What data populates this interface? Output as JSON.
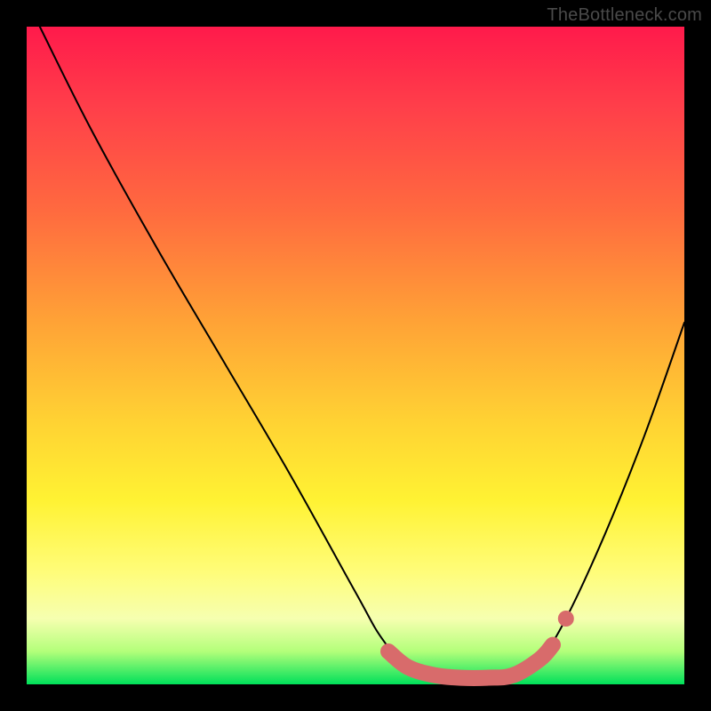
{
  "attribution": "TheBottleneck.com",
  "chart_data": {
    "type": "line",
    "title": "",
    "xlabel": "",
    "ylabel": "",
    "xlim": [
      0,
      100
    ],
    "ylim": [
      0,
      100
    ],
    "grid": false,
    "legend": false,
    "annotations": [],
    "series": [
      {
        "name": "curve",
        "color": "#000000",
        "x": [
          2,
          10,
          20,
          30,
          40,
          50,
          54,
          58,
          62,
          66,
          70,
          74,
          78,
          82,
          88,
          94,
          100
        ],
        "values": [
          100,
          84,
          66,
          49,
          32,
          14,
          7,
          2.6,
          1.4,
          1.0,
          1.0,
          1.4,
          3.8,
          10,
          23,
          38,
          55
        ]
      }
    ],
    "flat_region": {
      "color": "#d86b6b",
      "x": [
        55,
        58,
        62,
        66,
        70,
        74,
        78,
        80
      ],
      "values": [
        5.0,
        2.6,
        1.4,
        1.0,
        1.0,
        1.4,
        3.8,
        6.0
      ]
    },
    "marker": {
      "color": "#d86b6b",
      "x": 82,
      "value": 10
    }
  }
}
